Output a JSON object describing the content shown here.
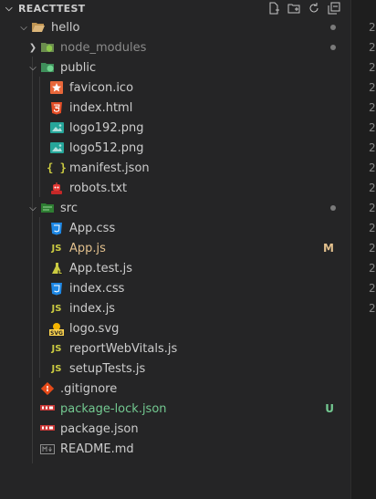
{
  "explorer": {
    "section_title": "REACTTEST",
    "actions": [
      "new-file-icon",
      "new-folder-icon",
      "refresh-icon",
      "collapse-all-icon"
    ]
  },
  "tree": {
    "hello": "hello",
    "node_modules": "node_modules",
    "public": "public",
    "favicon": "favicon.ico",
    "index_html": "index.html",
    "logo192": "logo192.png",
    "logo512": "logo512.png",
    "manifest": "manifest.json",
    "robots": "robots.txt",
    "src": "src",
    "app_css": "App.css",
    "app_js": "App.js",
    "app_js_status": "M",
    "app_test": "App.test.js",
    "index_css": "index.css",
    "index_js": "index.js",
    "logo_svg": "logo.svg",
    "report": "reportWebVitals.js",
    "setup": "setupTests.js",
    "gitignore": ".gitignore",
    "pkg_lock": "package-lock.json",
    "pkg_lock_status": "U",
    "pkg": "package.json",
    "readme": "README.md"
  },
  "editor": {
    "line_prefix": [
      "2",
      "2",
      "2",
      "2",
      "2",
      "2",
      "2",
      "2",
      "2",
      "2",
      "2",
      "2",
      "2",
      "2",
      "2"
    ]
  },
  "colors": {
    "modified": "#e2c08d",
    "untracked": "#73c991",
    "sidebar": "#252526"
  }
}
